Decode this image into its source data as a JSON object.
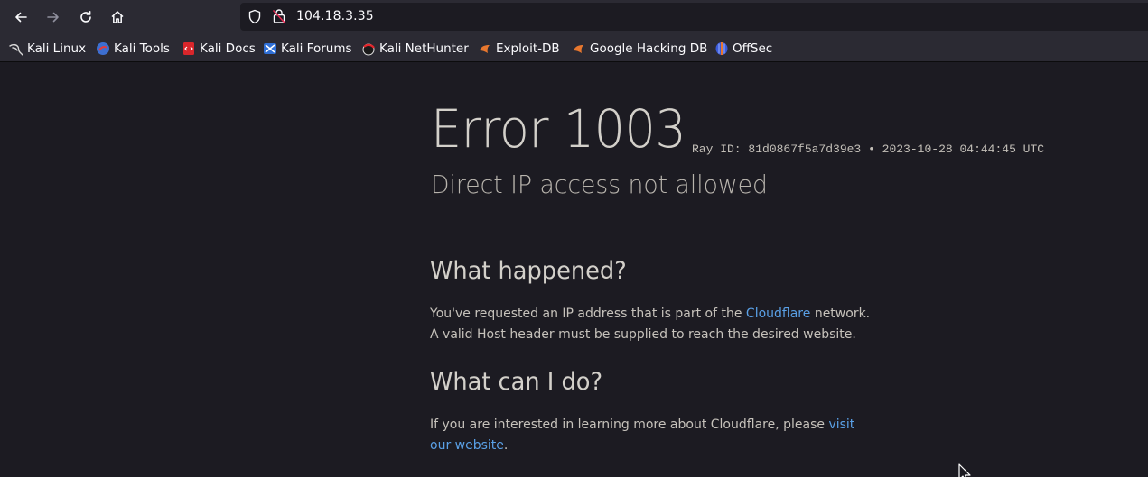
{
  "browser": {
    "url": "104.18.3.35",
    "bookmarks": [
      {
        "label": "Kali Linux",
        "icon": "kali-dragon-icon"
      },
      {
        "label": "Kali Tools",
        "icon": "kali-tools-icon"
      },
      {
        "label": "Kali Docs",
        "icon": "kali-docs-icon"
      },
      {
        "label": "Kali Forums",
        "icon": "kali-forums-icon"
      },
      {
        "label": "Kali NetHunter",
        "icon": "kali-nethunter-icon"
      },
      {
        "label": "Exploit-DB",
        "icon": "exploit-db-icon"
      },
      {
        "label": "Google Hacking DB",
        "icon": "ghdb-icon"
      },
      {
        "label": "OffSec",
        "icon": "offsec-icon"
      }
    ]
  },
  "page": {
    "error_title": "Error 1003",
    "ray_id": "Ray ID: 81d0867f5a7d39e3 •",
    "timestamp": "2023-10-28 04:44:45 UTC",
    "subtitle": "Direct IP access not allowed",
    "what_happened": {
      "heading": "What happened?",
      "text_before": "You've requested an IP address that is part of the ",
      "link": "Cloudflare",
      "text_after": " network. A valid Host header must be supplied to reach the desired website."
    },
    "what_can_i_do": {
      "heading": "What can I do?",
      "text_before": "If you are interested in learning more about Cloudflare, please ",
      "link": "visit our website",
      "text_after": "."
    }
  },
  "colors": {
    "toolbar_bg": "#2b2a33",
    "page_bg": "#1c1b22",
    "link": "#5aa0e6"
  }
}
